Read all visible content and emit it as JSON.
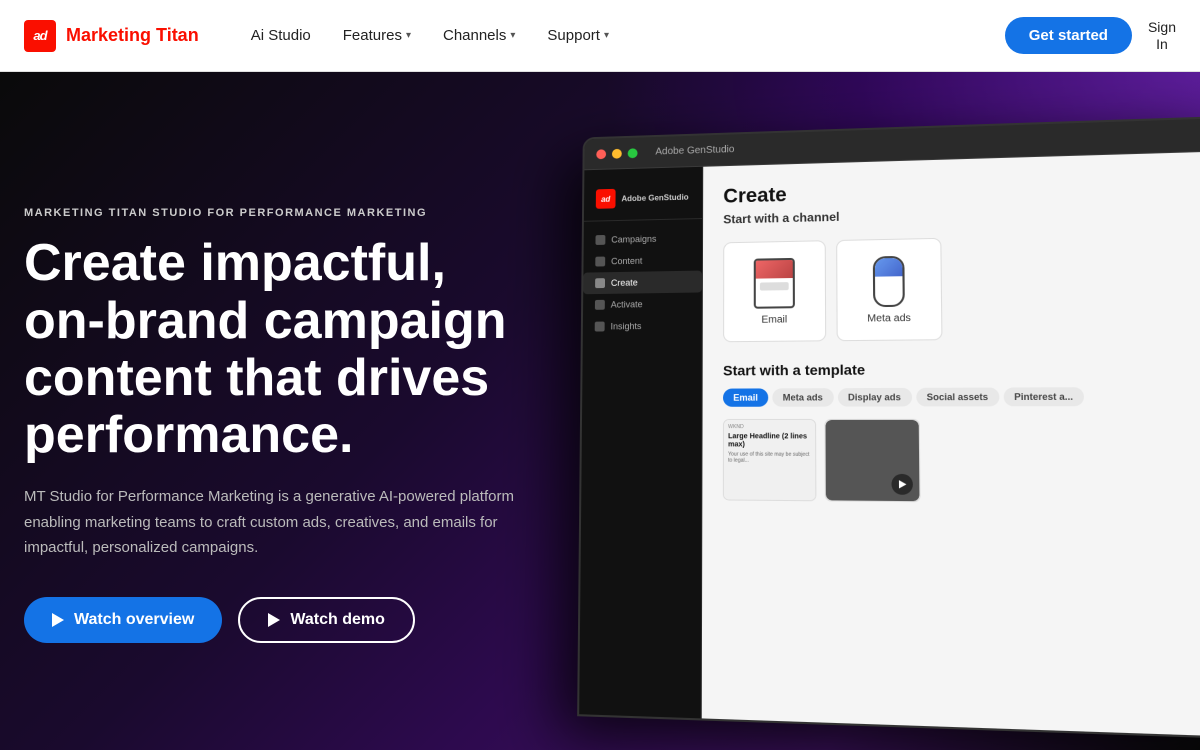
{
  "brand": {
    "logo_text": "ad",
    "name": "Marketing Titan"
  },
  "navbar": {
    "links": [
      {
        "label": "Ai Studio",
        "has_dropdown": false
      },
      {
        "label": "Features",
        "has_dropdown": true
      },
      {
        "label": "Channels",
        "has_dropdown": true
      },
      {
        "label": "Support",
        "has_dropdown": true
      }
    ],
    "cta_label": "Get started",
    "sign_in_line1": "Sign",
    "sign_in_line2": "In"
  },
  "hero": {
    "eyebrow": "MARKETING TITAN STUDIO FOR PERFORMANCE MARKETING",
    "title": "Create impactful, on-brand campaign content that drives performance.",
    "description": "MT Studio for Performance Marketing is a generative AI-powered platform enabling marketing teams to craft custom ads, creatives, and emails for impactful, personalized campaigns.",
    "btn_overview": "Watch overview",
    "btn_demo": "Watch demo"
  },
  "mockup": {
    "app_name": "Adobe GenStudio",
    "sidebar_items": [
      "Campaigns",
      "Content",
      "Create",
      "Activate",
      "Insights"
    ],
    "main_title": "Create",
    "channel_subtitle": "Start with a channel",
    "cards": [
      {
        "label": "Email",
        "type": "email"
      },
      {
        "label": "Meta ads",
        "type": "meta"
      }
    ],
    "template_subtitle": "Start with a template",
    "tabs": [
      "Email",
      "Meta ads",
      "Display ads",
      "Social assets",
      "Pinterest a..."
    ]
  },
  "colors": {
    "brand_red": "#fa0f00",
    "brand_blue": "#1473e6",
    "accent_purple": "#7c3aed"
  }
}
